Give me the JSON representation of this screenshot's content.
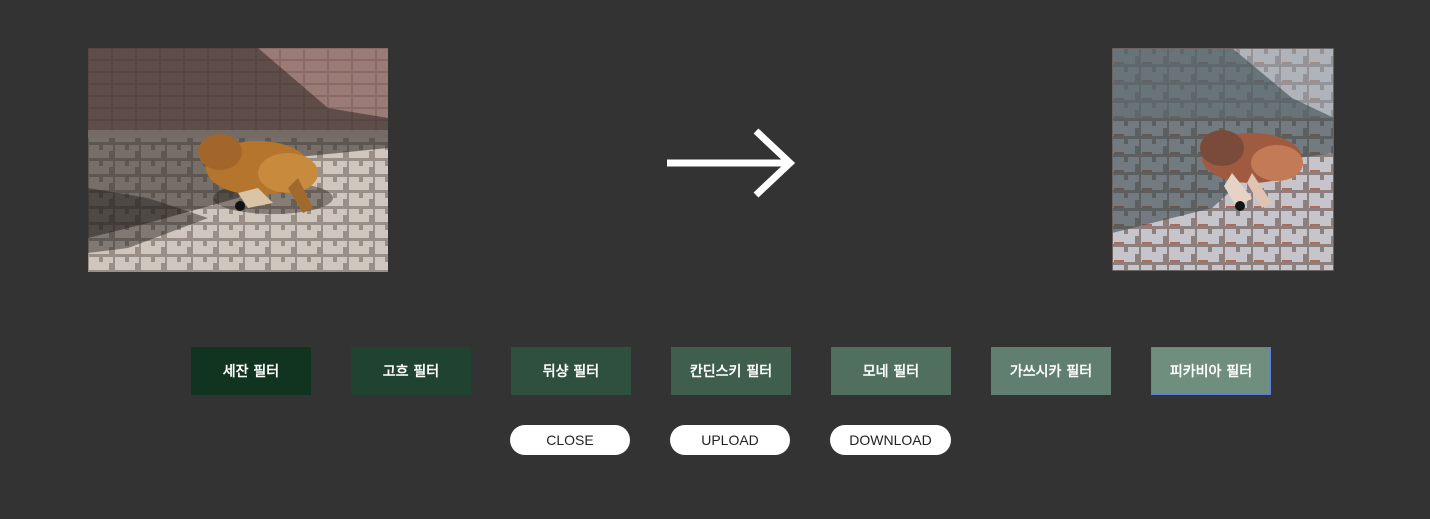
{
  "filters": [
    {
      "label": "세잔 필터",
      "color": "#113420"
    },
    {
      "label": "고흐 필터",
      "color": "#1f4330"
    },
    {
      "label": "뒤샹 필터",
      "color": "#2f503f"
    },
    {
      "label": "칸딘스키 필터",
      "color": "#3f5e4e"
    },
    {
      "label": "모네 필터",
      "color": "#506f5f"
    },
    {
      "label": "가쓰시카 필터",
      "color": "#617f70"
    },
    {
      "label": "피카비아 필터",
      "color": "#6f8e7e",
      "selected": true
    }
  ],
  "actions": {
    "close_label": "CLOSE",
    "upload_label": "UPLOAD",
    "download_label": "DOWNLOAD"
  },
  "colors": {
    "background": "#333333",
    "selected_border": "#5b7fd6",
    "pill_background": "#ffffff"
  },
  "icons": {
    "arrow": "arrow-right-icon"
  }
}
